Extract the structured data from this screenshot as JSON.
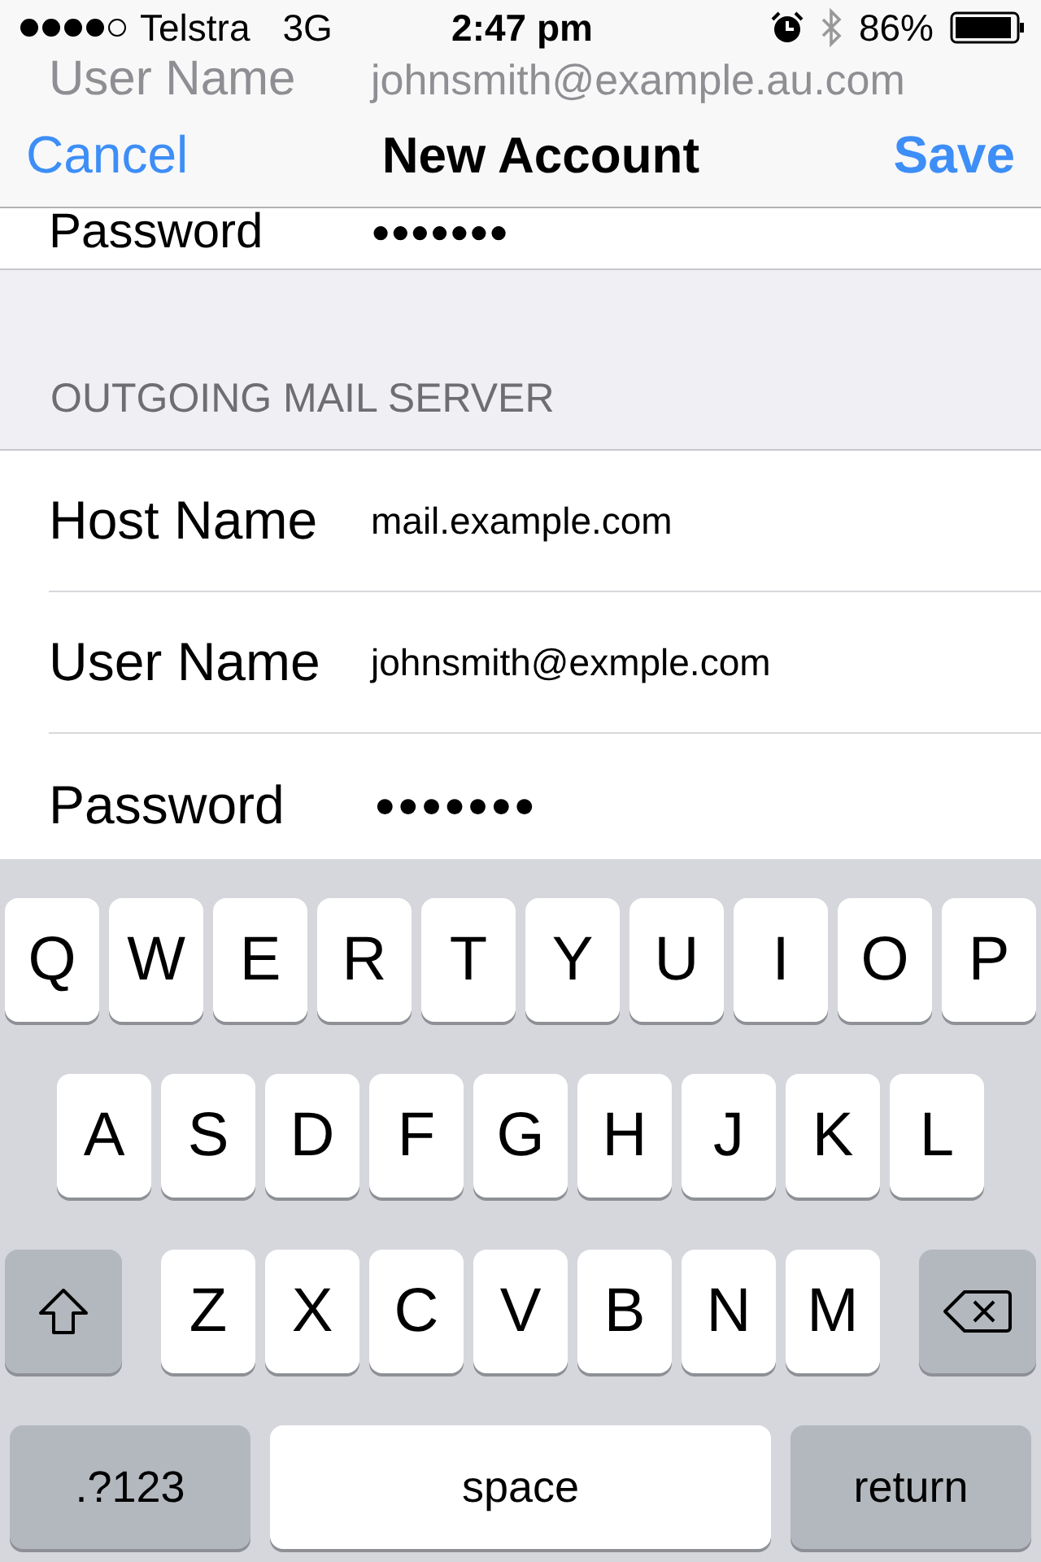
{
  "status_bar": {
    "carrier": "Telstra",
    "network": "3G",
    "time": "2:47 pm",
    "battery": "86%"
  },
  "nav_bar": {
    "left": "Cancel",
    "title": "New Account",
    "right": "Save"
  },
  "scrolled_rows": [
    {
      "label": "User Name",
      "value": "johnsmith@example.au.com"
    },
    {
      "label": "Password",
      "value": "●●●●●●●"
    }
  ],
  "section": {
    "header": "OUTGOING MAIL SERVER",
    "rows": [
      {
        "label": "Host Name",
        "value": "mail.example.com"
      },
      {
        "label": "User Name",
        "value": "johnsmith@exmple.com"
      },
      {
        "label": "Password",
        "value": "●●●●●●●"
      }
    ]
  },
  "keyboard": {
    "rows": [
      {
        "keys": [
          {
            "kind": "letter",
            "label": "Q"
          },
          {
            "kind": "letter",
            "label": "W"
          },
          {
            "kind": "letter",
            "label": "E"
          },
          {
            "kind": "letter",
            "label": "R"
          },
          {
            "kind": "letter",
            "label": "T"
          },
          {
            "kind": "letter",
            "label": "Y"
          },
          {
            "kind": "letter",
            "label": "U"
          },
          {
            "kind": "letter",
            "label": "I"
          },
          {
            "kind": "letter",
            "label": "O"
          },
          {
            "kind": "letter",
            "label": "P"
          }
        ]
      },
      {
        "keys": [
          {
            "kind": "letter",
            "label": "A"
          },
          {
            "kind": "letter",
            "label": "S"
          },
          {
            "kind": "letter",
            "label": "D"
          },
          {
            "kind": "letter",
            "label": "F"
          },
          {
            "kind": "letter",
            "label": "G"
          },
          {
            "kind": "letter",
            "label": "H"
          },
          {
            "kind": "letter",
            "label": "J"
          },
          {
            "kind": "letter",
            "label": "K"
          },
          {
            "kind": "letter",
            "label": "L"
          }
        ]
      },
      {
        "keys": [
          {
            "kind": "shift"
          },
          {
            "kind": "letter",
            "label": "Z"
          },
          {
            "kind": "letter",
            "label": "X"
          },
          {
            "kind": "letter",
            "label": "C"
          },
          {
            "kind": "letter",
            "label": "V"
          },
          {
            "kind": "letter",
            "label": "B"
          },
          {
            "kind": "letter",
            "label": "N"
          },
          {
            "kind": "letter",
            "label": "M"
          },
          {
            "kind": "delete"
          }
        ]
      },
      {
        "keys": [
          {
            "kind": "mode",
            "label": ".?123"
          },
          {
            "kind": "space",
            "label": "space"
          },
          {
            "kind": "return",
            "label": "return"
          }
        ]
      }
    ]
  }
}
